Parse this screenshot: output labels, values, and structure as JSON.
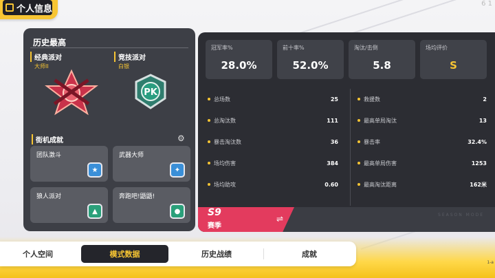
{
  "header": {
    "title": "个人信息",
    "title_icon": "profile-icon",
    "topright": "6 1"
  },
  "history": {
    "section_title": "历史最高",
    "modes": [
      {
        "label": "经典派对",
        "rank": "大师II",
        "emblem": "crossed-guns-star-icon"
      },
      {
        "label": "竞技派对",
        "rank": "白银",
        "emblem": "pk-shield-icon"
      }
    ]
  },
  "arcade": {
    "title": "街机成就",
    "settings_icon": "gear-icon",
    "cards": [
      {
        "name": "团队激斗",
        "badge_icon": "team-shield-icon",
        "color": "#3a8fd8"
      },
      {
        "name": "武器大师",
        "badge_icon": "weapon-shield-icon",
        "color": "#3a8fd8"
      },
      {
        "name": "狼人派对",
        "badge_icon": "wolf-shield-icon",
        "color": "#2aa07a"
      },
      {
        "name": "奔跑吧!鼯鼯!",
        "badge_icon": "squirrel-shield-icon",
        "color": "#2aa07a"
      }
    ]
  },
  "top_stats": [
    {
      "label": "冠军率%",
      "value": "28.0%"
    },
    {
      "label": "前十率%",
      "value": "52.0%"
    },
    {
      "label": "淘汰/击倒",
      "value": "5.8"
    },
    {
      "label": "场均评价",
      "value": "S"
    }
  ],
  "stats_left": [
    {
      "label": "总场数",
      "value": "25"
    },
    {
      "label": "总淘汰数",
      "value": "111"
    },
    {
      "label": "暴击淘汰数",
      "value": "36"
    },
    {
      "label": "场均伤害",
      "value": "384"
    },
    {
      "label": "场均助攻",
      "value": "0.60"
    }
  ],
  "stats_right": [
    {
      "label": "救援数",
      "value": "2"
    },
    {
      "label": "最高单局淘汰",
      "value": "13"
    },
    {
      "label": "暴击率",
      "value": "32.4%"
    },
    {
      "label": "最高单局伤害",
      "value": "1253"
    },
    {
      "label": "最高淘汰距离",
      "value": "162米"
    }
  ],
  "season": {
    "number": "S9",
    "label": "赛季",
    "swap_icon": "swap-arrows-icon",
    "faint_text": "SEASON MODE"
  },
  "tabs": [
    {
      "label": "个人空间",
      "active": false
    },
    {
      "label": "模式数据",
      "active": true
    },
    {
      "label": "历史战绩",
      "active": false
    },
    {
      "label": "成就",
      "active": false
    }
  ],
  "corner_label": "1-a",
  "colors": {
    "accent": "#f7c533",
    "panel": "#3d3f46",
    "season_red": "#e33b5e"
  }
}
